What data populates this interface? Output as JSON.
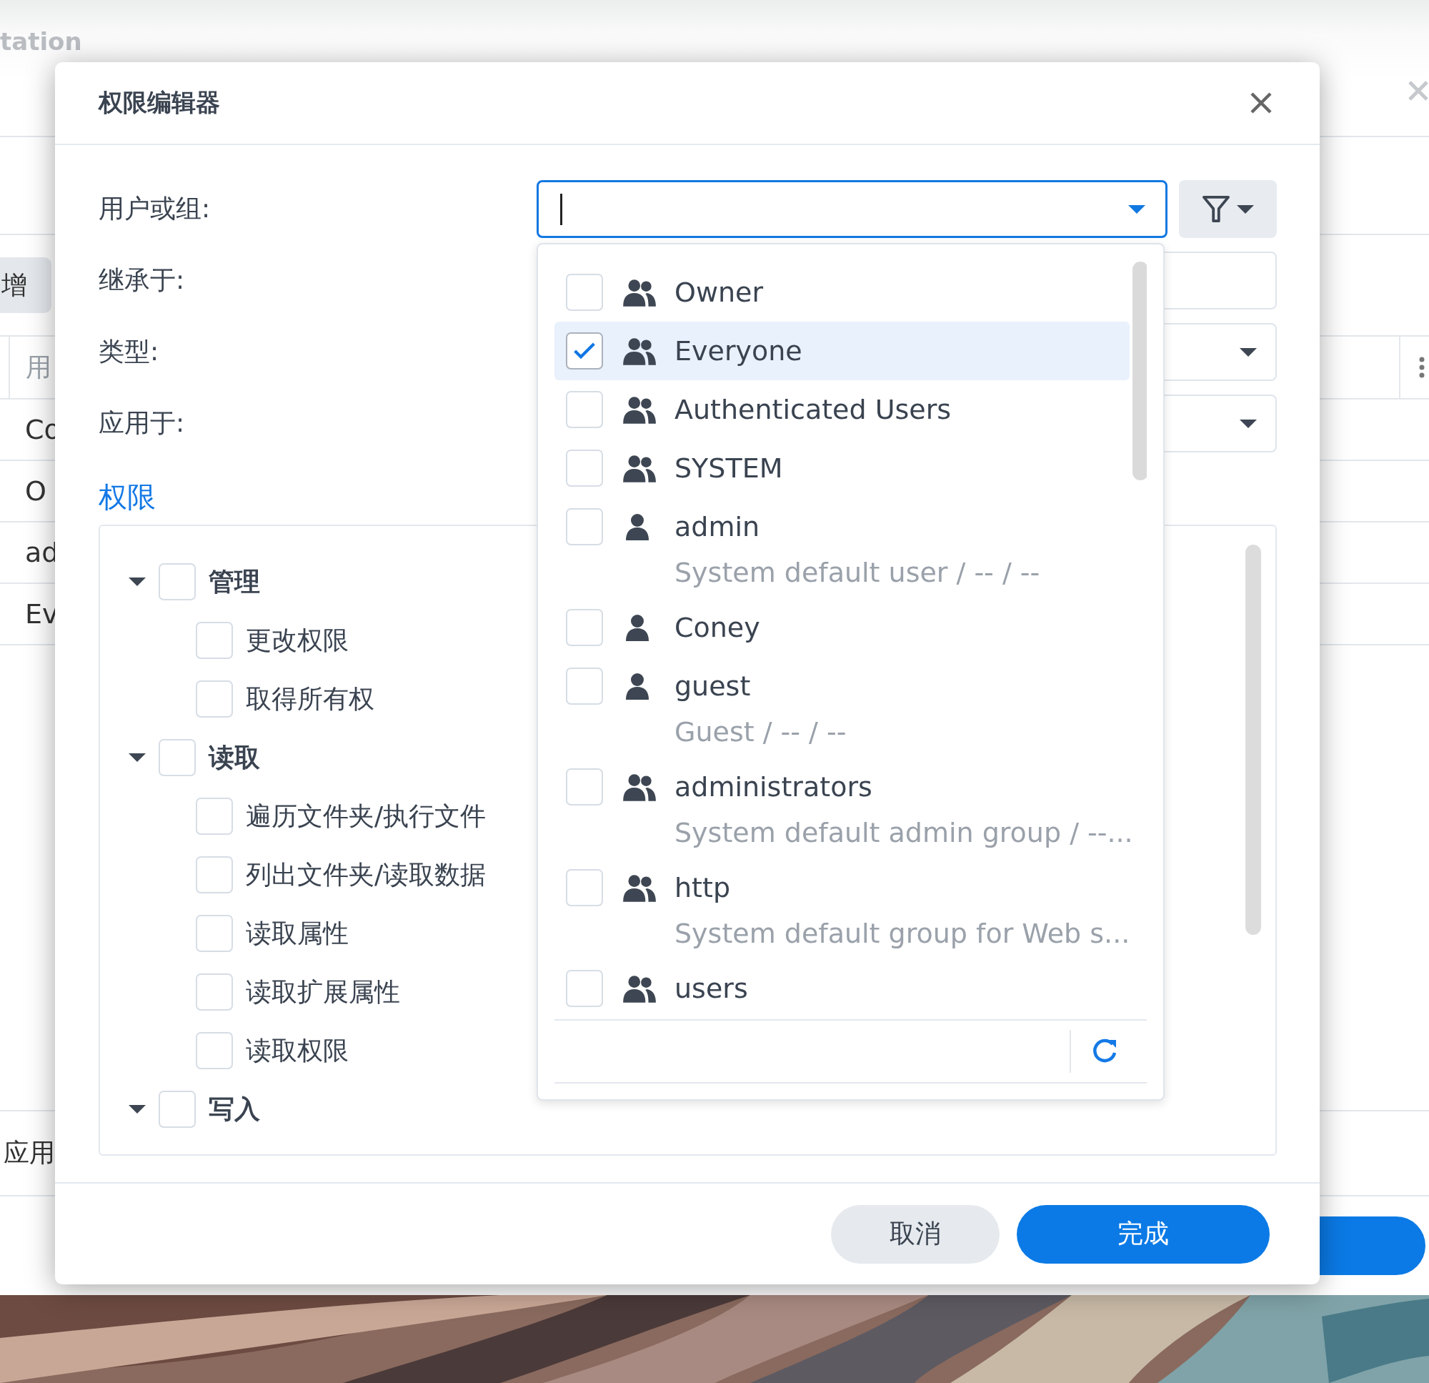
{
  "background_window": {
    "title": "tation",
    "toolbar_button": "增",
    "table": {
      "column_1": "用",
      "rows": [
        {
          "column_1": "Co"
        },
        {
          "column_1": "O"
        },
        {
          "column_1": "ad"
        },
        {
          "column_1": "Ev"
        }
      ]
    },
    "footer_label": "应用"
  },
  "dialog": {
    "title": "权限编辑器",
    "fields": [
      {
        "label": "用户或组:",
        "kind": "combo"
      },
      {
        "label": "继承于:",
        "kind": "text"
      },
      {
        "label": "类型:",
        "kind": "select"
      },
      {
        "label": "应用于:",
        "kind": "select"
      }
    ],
    "section_title": "权限",
    "permissions": [
      {
        "label": "管理",
        "checked": false,
        "expanded": true,
        "children": [
          {
            "label": "更改权限",
            "checked": false
          },
          {
            "label": "取得所有权",
            "checked": false
          }
        ]
      },
      {
        "label": "读取",
        "checked": false,
        "expanded": true,
        "children": [
          {
            "label": "遍历文件夹/执行文件",
            "checked": false
          },
          {
            "label": "列出文件夹/读取数据",
            "checked": false
          },
          {
            "label": "读取属性",
            "checked": false
          },
          {
            "label": "读取扩展属性",
            "checked": false
          },
          {
            "label": "读取权限",
            "checked": false
          }
        ]
      },
      {
        "label": "写入",
        "checked": false,
        "expanded": true
      }
    ],
    "user_dropdown": {
      "items": [
        {
          "name": "Owner",
          "kind": "group",
          "checked": false,
          "selected": false
        },
        {
          "name": "Everyone",
          "kind": "group",
          "checked": true,
          "selected": true
        },
        {
          "name": "Authenticated Users",
          "kind": "group",
          "checked": false,
          "selected": false
        },
        {
          "name": "SYSTEM",
          "kind": "group",
          "checked": false,
          "selected": false
        },
        {
          "name": "admin",
          "kind": "user",
          "checked": false,
          "selected": false,
          "description": "System default user / -- / --"
        },
        {
          "name": "Coney",
          "kind": "user",
          "checked": false,
          "selected": false
        },
        {
          "name": "guest",
          "kind": "user",
          "checked": false,
          "selected": false,
          "description": "Guest / -- / --"
        },
        {
          "name": "administrators",
          "kind": "group",
          "checked": false,
          "selected": false,
          "description": "System default admin group / --..."
        },
        {
          "name": "http",
          "kind": "group",
          "checked": false,
          "selected": false,
          "description": "System default group for Web s..."
        },
        {
          "name": "users",
          "kind": "group",
          "checked": false,
          "selected": false
        }
      ]
    },
    "buttons": [
      {
        "label": "取消",
        "kind": "secondary"
      },
      {
        "label": "完成",
        "kind": "primary"
      }
    ]
  }
}
